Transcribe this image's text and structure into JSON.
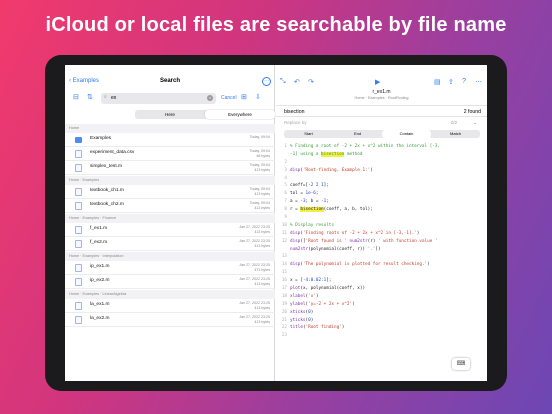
{
  "headline": "iCloud or local files are searchable by file name",
  "status": {
    "time": "11:50 PM",
    "date": "Sun Jan 23",
    "battery": "100%"
  },
  "left_nav": {
    "back": "Examples",
    "title": "Search"
  },
  "search": {
    "query": "ex",
    "cancel": "Cancel"
  },
  "scope": {
    "here": "Here",
    "everywhere": "Everywhere"
  },
  "sections": [
    {
      "path": "Home",
      "rows": [
        {
          "name": "Examples",
          "meta1": "Today, 09:04",
          "meta2": "",
          "folder": true
        },
        {
          "name": "experiment_data.csv",
          "meta1": "Today, 09:04",
          "meta2": "48 bytes"
        },
        {
          "name": "simplex_test.m",
          "meta1": "Today, 09:04",
          "meta2": "413 bytes"
        }
      ]
    },
    {
      "path": "Home · Examples",
      "rows": [
        {
          "name": "textbook_ch1.m",
          "meta1": "Today, 09:04",
          "meta2": "413 bytes"
        },
        {
          "name": "textbook_ch2.m",
          "meta1": "Today, 09:04",
          "meta2": "413 bytes"
        }
      ]
    },
    {
      "path": "Home · Examples · Finance",
      "rows": [
        {
          "name": "f_ex1.m",
          "meta1": "Jan 27, 2022 23:25",
          "meta2": "413 bytes"
        },
        {
          "name": "f_ex2.m",
          "meta1": "Jan 27, 2022 23:25",
          "meta2": "413 bytes"
        }
      ]
    },
    {
      "path": "Home · Examples · Interpolation",
      "rows": [
        {
          "name": "ip_ex1.m",
          "meta1": "Jan 27, 2022 23:25",
          "meta2": "471 bytes"
        },
        {
          "name": "ip_ex2.m",
          "meta1": "Jan 27, 2022 23:25",
          "meta2": "413 bytes"
        }
      ]
    },
    {
      "path": "Home · Examples · LinearAlgebra",
      "rows": [
        {
          "name": "la_ex1.m",
          "meta1": "Jan 27, 2022 23:25",
          "meta2": "413 bytes"
        },
        {
          "name": "la_ex2.m",
          "meta1": "Jan 27, 2022 23:25",
          "meta2": "413 bytes"
        }
      ]
    }
  ],
  "editor": {
    "file": "r_ex1.m",
    "path": "Home · Examples · RootFinding",
    "find_text": "bisection",
    "found": "2 found",
    "replace_placeholder": "Replace by",
    "replace_count": "2/2",
    "options": [
      "Start",
      "End",
      "Contain",
      "Match"
    ]
  },
  "code_lines": [
    {
      "n": "1",
      "html": "<span class='c'>% Finding a root of -2 + 2x + x^2 within the interval [-3,</span>"
    },
    {
      "n": "",
      "html": "<span class='c'>-1] using a </span><span class='c hl'>bisection</span><span class='c'> method</span>"
    },
    {
      "n": "2",
      "html": ""
    },
    {
      "n": "3",
      "html": "<span class='kw'>disp</span>(<span class='str'>'Root-finding, Example 1:'</span>)"
    },
    {
      "n": "4",
      "html": ""
    },
    {
      "n": "5",
      "html": "coeff=[<span class='num'>-2 2 1</span>];"
    },
    {
      "n": "6",
      "html": "tol = <span class='num'>1e-6</span>;"
    },
    {
      "n": "7",
      "html": "a = <span class='num'>-3</span>; b = <span class='num'>-1</span>;"
    },
    {
      "n": "8",
      "html": "r = <span class='hl'>bisection</span>(coeff, a, b, tol);"
    },
    {
      "n": "9",
      "html": ""
    },
    {
      "n": "10",
      "html": "<span class='c'>% Display results</span>"
    },
    {
      "n": "11",
      "html": "<span class='kw'>disp</span>(<span class='str'>'Finding roots of -2 + 2x + x^2 in [-3,-1].'</span>)"
    },
    {
      "n": "12",
      "html": "<span class='kw'>disp</span>([<span class='str'>'Root found is '</span> <span class='kw'>num2str</span>(r) <span class='str'>' with function value '</span>"
    },
    {
      "n": "",
      "html": "<span class='kw'>num2str</span>(polynomial(coeff, r)) <span class='str'>'.'</span>])"
    },
    {
      "n": "13",
      "html": ""
    },
    {
      "n": "14",
      "html": "<span class='kw'>disp</span>(<span class='str'>'The polynomial is plotted for result checking.'</span>)"
    },
    {
      "n": "15",
      "html": ""
    },
    {
      "n": "16",
      "html": "x = [<span class='num'>-4:0.02:1</span>];"
    },
    {
      "n": "17",
      "html": "<span class='kw'>plot</span>(x, polynomial(coeff, x))"
    },
    {
      "n": "18",
      "html": "<span class='kw'>xlabel</span>(<span class='str'>'x'</span>)"
    },
    {
      "n": "19",
      "html": "<span class='kw'>ylabel</span>(<span class='str'>'y=-2 + 2x + x^2'</span>)"
    },
    {
      "n": "20",
      "html": "<span class='kw'>xticks</span>(<span class='num'>0</span>)"
    },
    {
      "n": "21",
      "html": "<span class='kw'>yticks</span>(<span class='num'>0</span>)"
    },
    {
      "n": "22",
      "html": "<span class='kw'>title</span>(<span class='str'>'Root finding'</span>)"
    },
    {
      "n": "23",
      "html": ""
    }
  ]
}
